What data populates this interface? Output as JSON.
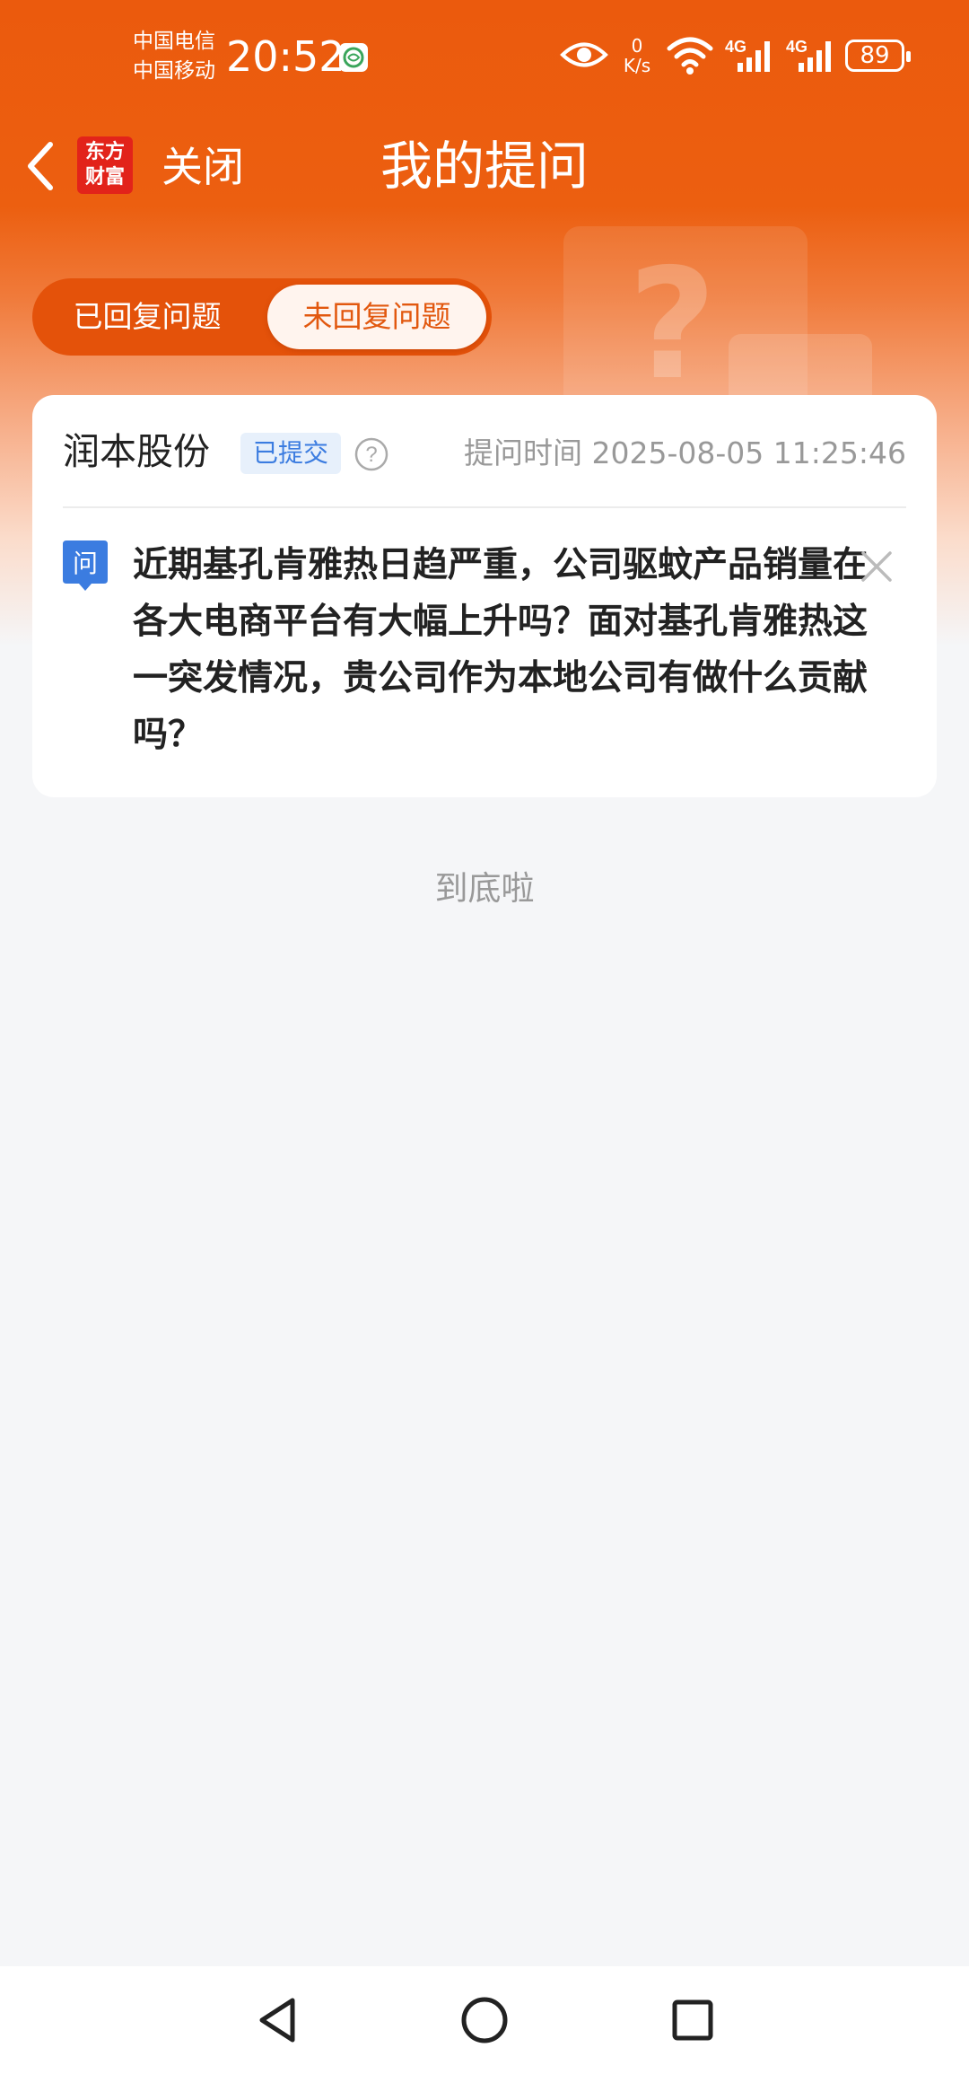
{
  "status_bar": {
    "carrier_1": "中国电信",
    "carrier_2": "中国移动",
    "time": "20:52",
    "net_speed_value": "0",
    "net_speed_unit": "K/s",
    "network_1": "4G",
    "network_2": "4G",
    "battery": "89"
  },
  "nav": {
    "logo_line1": "东方",
    "logo_line2": "财富",
    "close_label": "关闭",
    "title": "我的提问"
  },
  "tabs": [
    {
      "label": "已回复问题",
      "active": false
    },
    {
      "label": "未回复问题",
      "active": true
    }
  ],
  "question_card": {
    "company": "润本股份",
    "status": "已提交",
    "ask_time_label": "提问时间 2025-08-05 11:25:46",
    "question_badge": "问",
    "question": "近期基孔肯雅热日趋严重，公司驱蚊产品销量在各大电商平台有大幅上升吗？面对基孔肯雅热这一突发情况，贵公司作为本地公司有做什么贡献吗？"
  },
  "end_of_list": "到底啦",
  "colors": {
    "brand_orange": "#eb5a0d",
    "accent_blue": "#3b7ce0",
    "page_bg": "#f5f6f8"
  }
}
